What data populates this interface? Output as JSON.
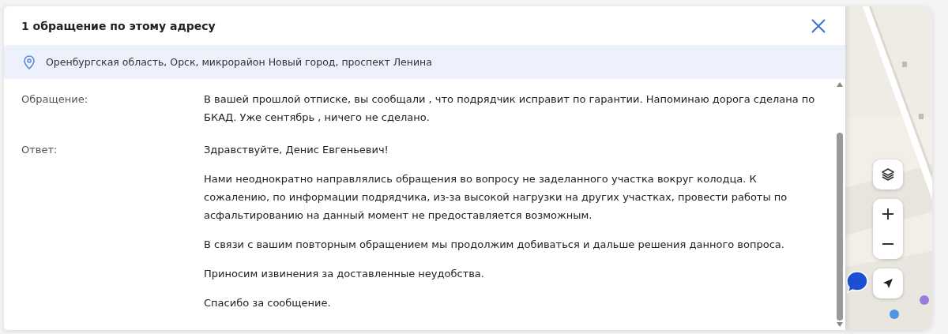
{
  "dialog": {
    "title": "1 обращение по этому адресу",
    "address": "Оренбургская область, Орск, микрорайон Новый город, проспект Ленина",
    "fields": [
      {
        "label": "Обращение:",
        "paragraphs": [
          "В вашей прошлой отписке, вы сообщали , что подрядчик исправит по гарантии. Напоминаю дорога сделана по БКАД. Уже сентябрь , ничего не сделано."
        ]
      },
      {
        "label": "Ответ:",
        "paragraphs": [
          "Здравствуйте, Денис Евгеньевич!",
          "Нами неоднократно направлялись обращения во вопросу не заделанного  участка вокруг колодца. К сожалению, по информации подрядчика, из-за высокой нагрузки на других участках, провести работы по асфальтированию на данный момент не предоставляется возможным.",
          "В связи с вашим повторным обращением мы продолжим добиваться и дальше решения данного вопроса.",
          "Приносим извинения за доставленные неудобства.",
          "Спасибо за сообщение."
        ]
      }
    ]
  }
}
